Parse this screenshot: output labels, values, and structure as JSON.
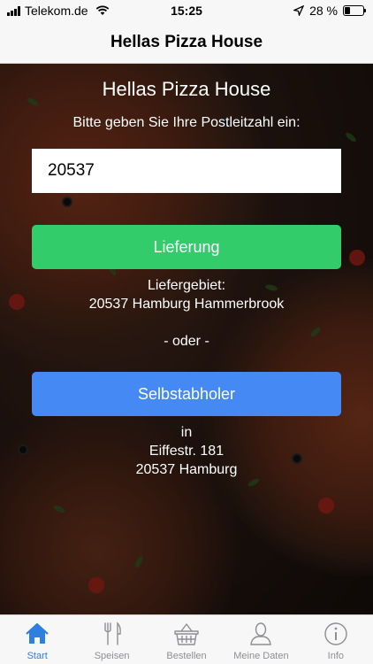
{
  "status_bar": {
    "carrier": "Telekom.de",
    "time": "15:25",
    "battery_percent": "28 %",
    "battery_level": 0.28
  },
  "nav": {
    "title": "Hellas Pizza House"
  },
  "main": {
    "headline": "Hellas Pizza House",
    "prompt": "Bitte geben Sie Ihre Postleitzahl ein:",
    "zip_value": "20537",
    "delivery_button": "Lieferung",
    "delivery_area_label": "Liefergebiet:",
    "delivery_area_value": "20537 Hamburg Hammerbrook",
    "or_text": "- oder -",
    "pickup_button": "Selbstabholer",
    "pickup_in": "in",
    "pickup_street": "Eiffestr. 181",
    "pickup_city": "20537 Hamburg"
  },
  "tabs": [
    {
      "label": "Start",
      "icon": "home-icon",
      "active": true
    },
    {
      "label": "Speisen",
      "icon": "cutlery-icon",
      "active": false
    },
    {
      "label": "Bestellen",
      "icon": "basket-icon",
      "active": false
    },
    {
      "label": "Meine Daten",
      "icon": "user-icon",
      "active": false
    },
    {
      "label": "Info",
      "icon": "info-icon",
      "active": false
    }
  ],
  "colors": {
    "delivery_button": "#33cc6a",
    "pickup_button": "#4589f5",
    "tab_active": "#2f7fe0",
    "tab_inactive": "#8e8e93"
  }
}
